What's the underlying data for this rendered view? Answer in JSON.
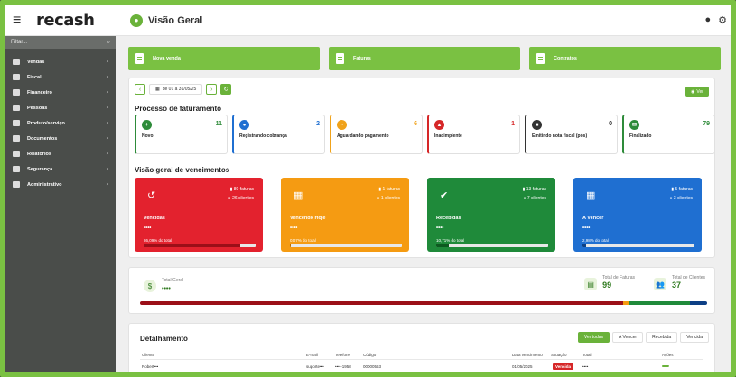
{
  "app": {
    "logo": "recash",
    "menu_icon": "≡",
    "page_title": "Visão Geral"
  },
  "top_right": {
    "user_icon": "user-icon",
    "settings_icon": "gear-icon"
  },
  "sidebar": {
    "filter_placeholder": "Filtar...",
    "items": [
      {
        "label": "Vendas"
      },
      {
        "label": "Fiscal"
      },
      {
        "label": "Financeiro"
      },
      {
        "label": "Pessoas"
      },
      {
        "label": "Produto/serviço"
      },
      {
        "label": "Documentos"
      },
      {
        "label": "Relatórios"
      },
      {
        "label": "Segurança"
      },
      {
        "label": "Administrativo"
      }
    ]
  },
  "shortcuts": [
    {
      "label": "Nova venda"
    },
    {
      "label": "Faturas"
    },
    {
      "label": "Contratos"
    }
  ],
  "toolbar": {
    "date_range": "de 01 a 31/05/25",
    "ver_label": "Ver"
  },
  "billing_process": {
    "title": "Processo de faturamento",
    "cards": [
      {
        "label": "Novo",
        "count": "11",
        "color": "#2e8b3a",
        "icon": "+",
        "dots": "----"
      },
      {
        "label": "Registrando cobrança",
        "count": "2",
        "color": "#1f6fd1",
        "icon": "●",
        "dots": "----"
      },
      {
        "label": "Aguardando pagamento",
        "count": "6",
        "color": "#f0a21a",
        "icon": "◔",
        "dots": "----"
      },
      {
        "label": "Inadimplente",
        "count": "1",
        "color": "#d62728",
        "icon": "▲",
        "dots": "----"
      },
      {
        "label": "Emitindo nota fiscal (pós)",
        "count": "0",
        "color": "#333333",
        "icon": "■",
        "dots": "----"
      },
      {
        "label": "Finalizado",
        "count": "79",
        "color": "#2e8b3a",
        "icon": "✉",
        "dots": "----"
      }
    ]
  },
  "due_overview": {
    "title": "Visão geral de vencimentos",
    "cards": [
      {
        "label": "Vencidas",
        "invoices": "80 faturas",
        "clients": "26 clientes",
        "value": "••••",
        "pct": "86,09% do total",
        "progress": 0.86,
        "color": "#e3222e",
        "fill": "#9b0f18",
        "icon": "clock-icon"
      },
      {
        "label": "Vencendo Hoje",
        "invoices": "1 faturas",
        "clients": "1 clientes",
        "value": "••••",
        "pct": "0,07% do total",
        "progress": 0.01,
        "color": "#f59b12",
        "fill": "#b66d00",
        "icon": "calendar-icon"
      },
      {
        "label": "Recebidas",
        "invoices": "13 faturas",
        "clients": "7 clientes",
        "value": "••••",
        "pct": "10,71% do total",
        "progress": 0.11,
        "color": "#1f8a3a",
        "fill": "#0d5a20",
        "icon": "check-icon"
      },
      {
        "label": "A Vencer",
        "invoices": "5 faturas",
        "clients": "3 clientes",
        "value": "••••",
        "pct": "2,98% do total",
        "progress": 0.03,
        "color": "#1f6fd1",
        "fill": "#0d3f85",
        "icon": "calendar-icon"
      }
    ]
  },
  "totals": {
    "label": "Total Geral",
    "value": "••••",
    "invoices_label": "Total de Faturas",
    "invoices_value": "99",
    "clients_label": "Total de Clientes",
    "clients_value": "37",
    "distribution": [
      0.86,
      0.01,
      0.11,
      0.03
    ]
  },
  "detail": {
    "title": "Detalhamento",
    "filters": [
      "Ver todas",
      "A Vencer",
      "Recebida",
      "Vencida"
    ],
    "columns": [
      "Cliente",
      "E-mail",
      "Telefone",
      "Código",
      "Data vencimento",
      "Situação",
      "Total",
      "Ações"
    ],
    "row": {
      "client": "Robert•••",
      "email": "suporte•••",
      "phone": "••••-1958",
      "code": "00000563",
      "due_date": "01/05/2025",
      "status": "Vencida",
      "total": "••••",
      "action": "Visualizar"
    }
  }
}
